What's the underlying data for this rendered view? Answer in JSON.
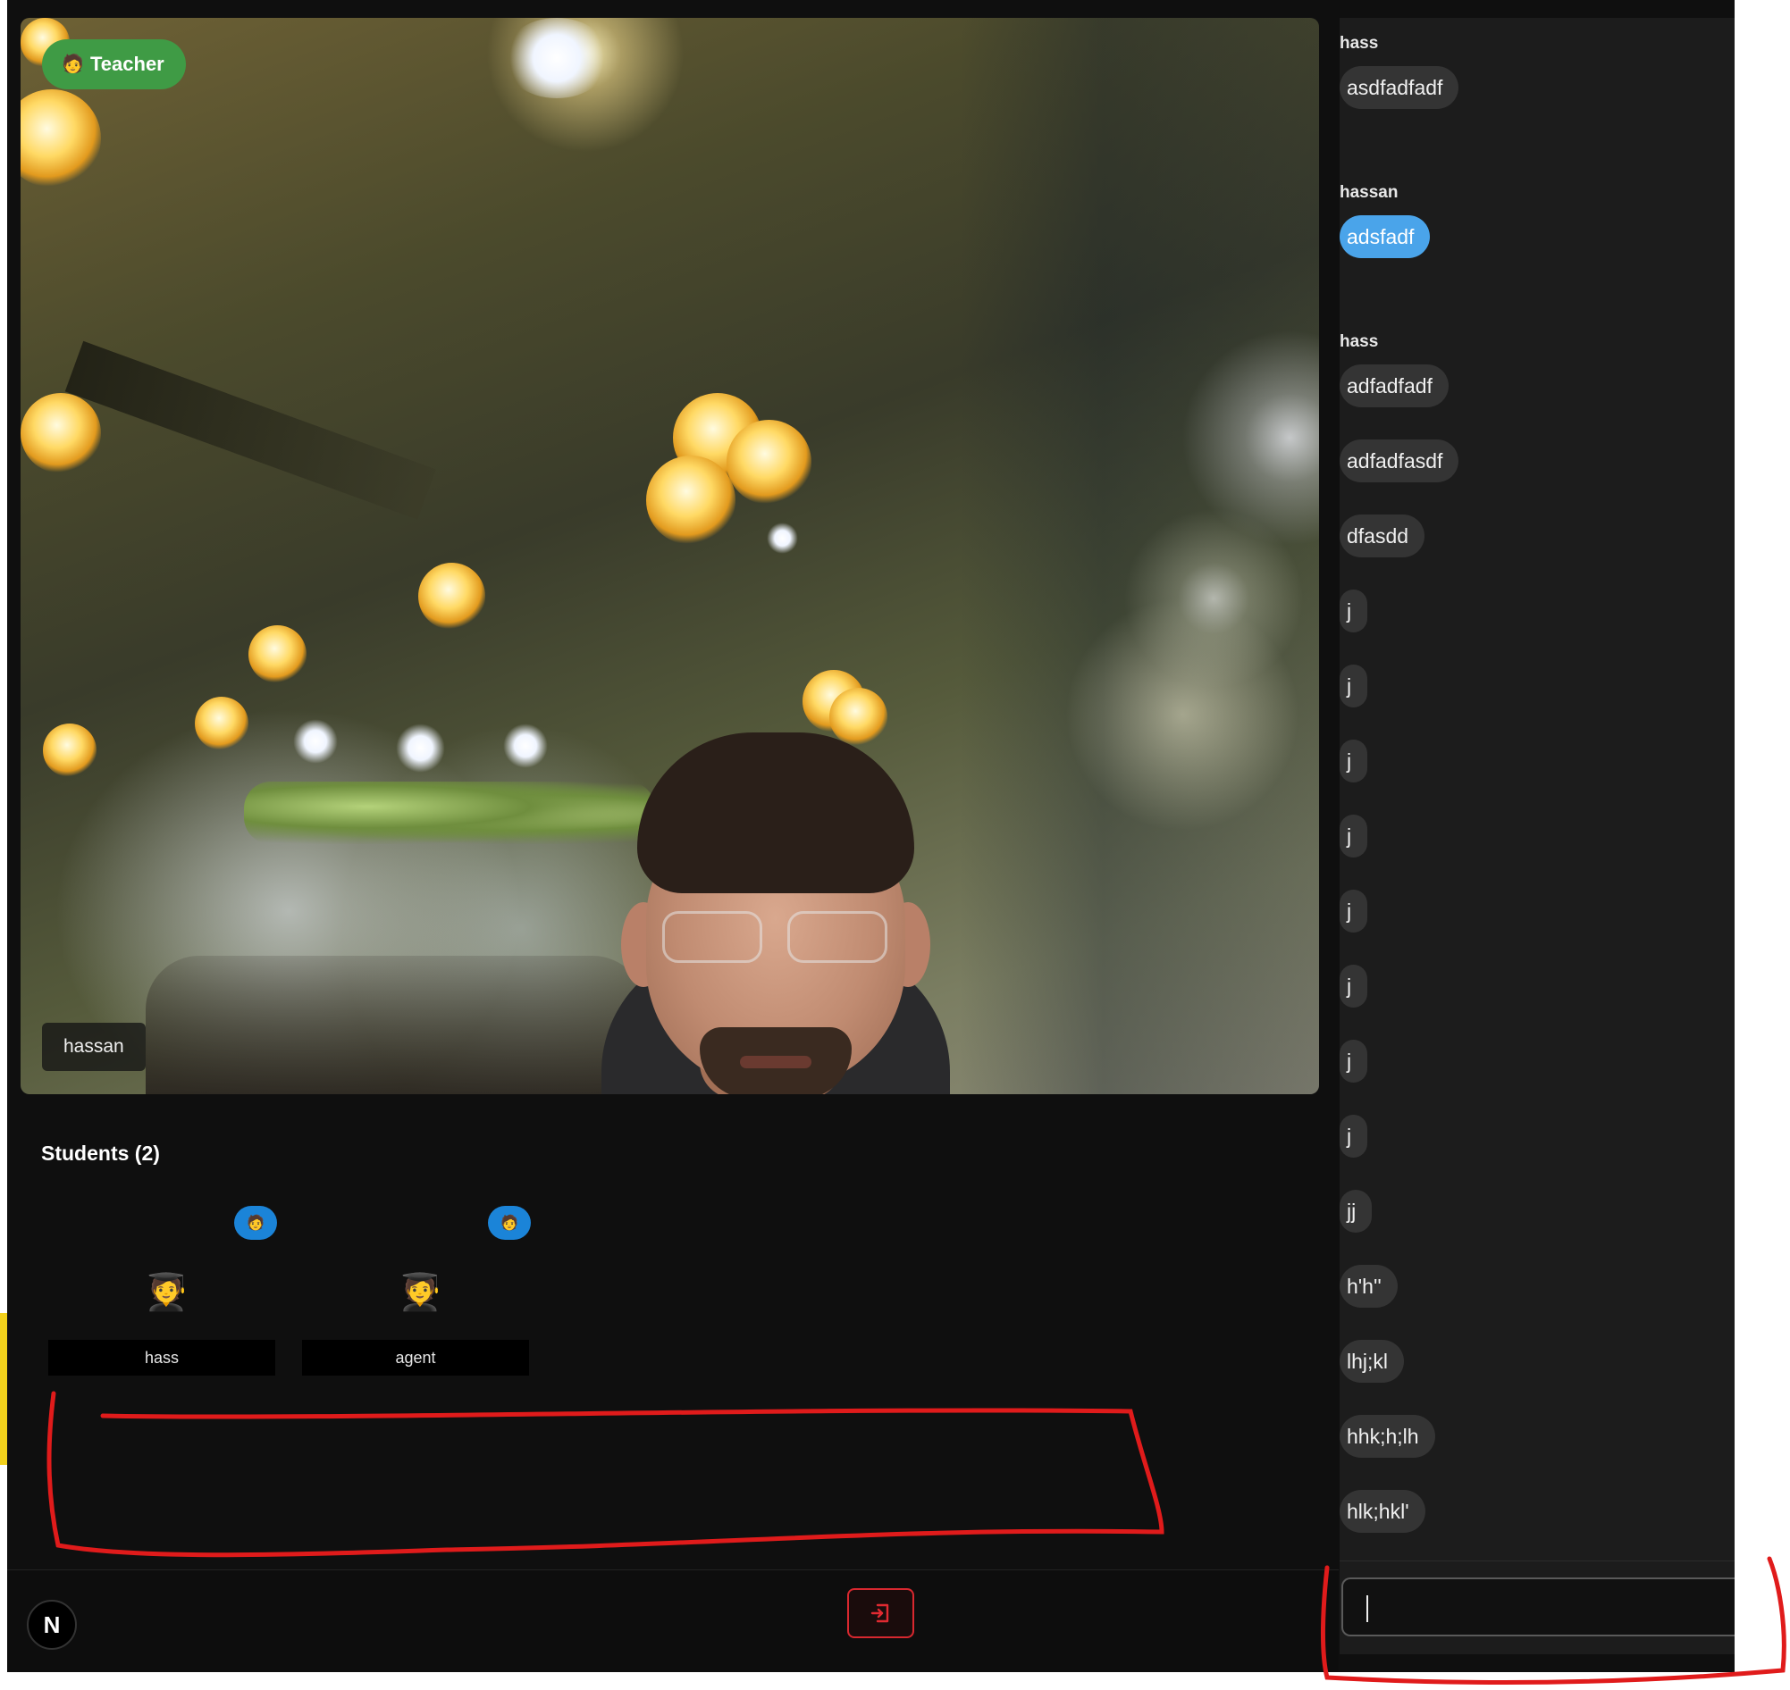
{
  "video": {
    "badge_label": "Teacher",
    "badge_icon": "teacher-emoji-icon",
    "participant_name": "hassan"
  },
  "students": {
    "title": "Students (2)",
    "items": [
      {
        "name": "hass",
        "role_icon": "student-emoji-icon",
        "avatar_icon": "graduate-emoji-icon"
      },
      {
        "name": "agent",
        "role_icon": "student-emoji-icon",
        "avatar_icon": "graduate-emoji-icon"
      }
    ]
  },
  "controls": {
    "logo_letter": "N",
    "leave_icon": "exit-icon",
    "leave_color": "#d8282f"
  },
  "chat": {
    "groups": [
      {
        "sender": "hass",
        "messages": [
          "asdfadfadf"
        ]
      },
      {
        "sender": "hassan",
        "mine": true,
        "messages": [
          "adsfadf"
        ]
      },
      {
        "sender": "hass",
        "messages": [
          "adfadfadf",
          "adfadfasdf",
          "dfasdd",
          "j",
          "j",
          "j",
          "j",
          "j",
          "j",
          "j",
          "j",
          "jj",
          "h'h''",
          "lhj;kl",
          "hhk;h;lh",
          "hlk;hkl'"
        ]
      }
    ],
    "input_value": "",
    "accent": "#4aa4ea"
  },
  "colors": {
    "teacher_badge": "#3f9b45",
    "student_badge": "#1b84d8",
    "annotation": "#e01b1b"
  }
}
